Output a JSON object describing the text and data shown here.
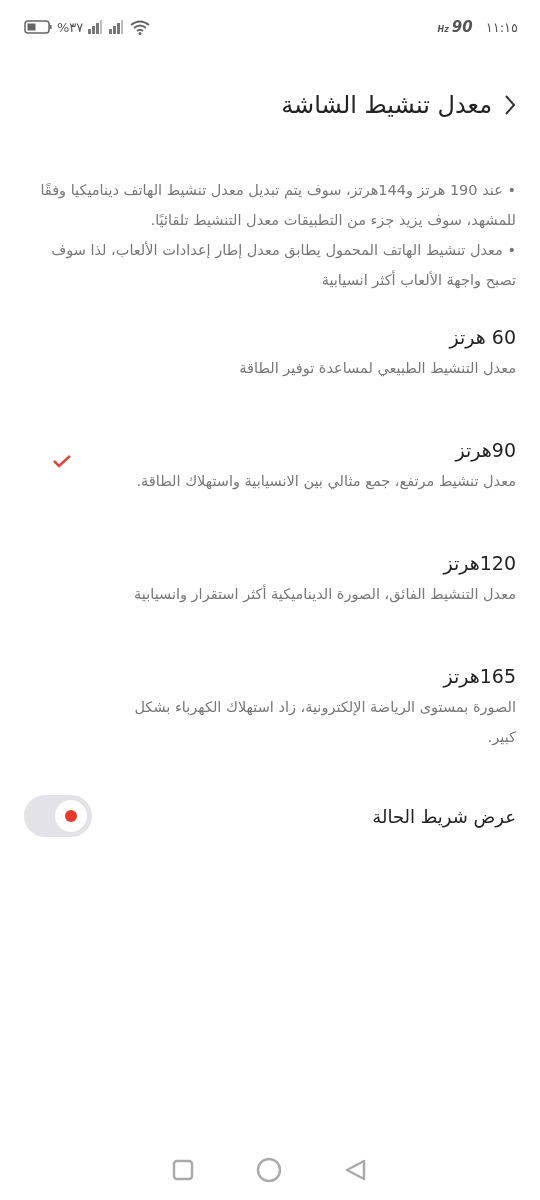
{
  "status_bar": {
    "time": "١١:١٥",
    "refresh_rate": "90",
    "refresh_unit": "Hz",
    "battery_percent": "%٣٧"
  },
  "header": {
    "title": "معدل تنشيط الشاشة"
  },
  "description": [
    "• عند 190 هرتز و144هرتز، سوف يتم تبديل معدل تنشيط الهاتف ديناميكيا وفقًا للمشهد، سوف يزيد جزء من التطبيقات معدل التنشيط تلقائيًا.",
    "• معدل تنشيط الهاتف المحمول يطابق معدل إطار إعدادات الألعاب، لذا سوف تصبح واجهة الألعاب أكثر انسيابية"
  ],
  "options": [
    {
      "title": "60 هرتز",
      "subtitle": "معدل التنشيط الطبيعي لمساعدة توفير الطاقة",
      "selected": false
    },
    {
      "title": "90هرتز",
      "subtitle": "معدل تنشيط مرتفع، جمع مثالي بين الانسيابية واستهلاك الطاقة.",
      "selected": true
    },
    {
      "title": "120هرتز",
      "subtitle": "معدل التنشيط الفائق، الصورة الديناميكية أكثر استقرار وانسيابية",
      "selected": false
    },
    {
      "title": "165هرتز",
      "subtitle": "الصورة بمستوى الرياضة الإلكترونية، زاد استهلاك الكهرباء بشكل كبير.",
      "selected": false
    }
  ],
  "status_bar_toggle": {
    "label": "عرض شريط الحالة",
    "on": true
  }
}
